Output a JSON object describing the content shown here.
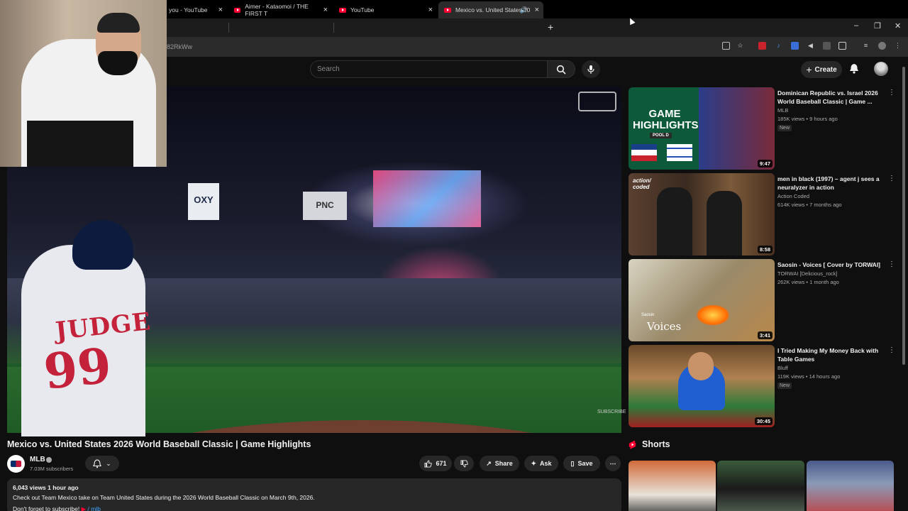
{
  "browser": {
    "tabs": [
      {
        "label": "you - YouTube",
        "active": false
      },
      {
        "label": "Aimer - Kataomoi / THE FIRST T",
        "active": false
      },
      {
        "label": "YouTube",
        "active": false
      },
      {
        "label": "Mexico vs. United States 20",
        "active": true
      }
    ],
    "new_tab": "+",
    "url_fragment": "82RkWw",
    "window_controls": {
      "minimize": "–",
      "restore": "❐",
      "close": "✕"
    }
  },
  "header": {
    "search_placeholder": "Search",
    "create_label": "Create"
  },
  "video": {
    "title": "Mexico vs. United States 2026 World Baseball Classic | Game Highlights",
    "jersey_name": "JUDGE",
    "jersey_number": "99",
    "ad_oxy": "OXY",
    "ad_pnc": "PNC",
    "watermark_subscribe": "SUBSCRIBE"
  },
  "channel": {
    "name": "MLB",
    "subscribers": "7.03M subscribers"
  },
  "actions": {
    "likes": "671",
    "share": "Share",
    "ask": "Ask",
    "save": "Save"
  },
  "description": {
    "meta": "6,043 views  1 hour ago",
    "line1": "Check out Team Mexico take on Team United States during the 2026 World Baseball Classic on March 9th, 2026.",
    "line2": "Don't forget to subscribe! ",
    "link": " / mlb"
  },
  "recommendations": [
    {
      "title": "Dominican Republic vs. Israel 2026 World Baseball Classic | Game ...",
      "channel": "MLB",
      "stats": "185K views • 9 hours ago",
      "badge": "New",
      "duration": "9:47",
      "thumb_text": "GAME HIGHLIGHTS",
      "thumb_sub": "POOL D"
    },
    {
      "title": "men in black (1997) – agent j sees a neuralyzer in action",
      "channel": "Action Coded",
      "stats": "614K views • 7 months ago",
      "badge": "",
      "duration": "8:58",
      "thumb_text": "action/ coded"
    },
    {
      "title": "Saosin - Voices  [ Cover by TORWAI]",
      "channel": "TORWAI [Delicious_rock]",
      "stats": "262K views • 1 month ago",
      "badge": "",
      "duration": "3:41",
      "thumb_text": "Voices",
      "thumb_sub": "Saosin"
    },
    {
      "title": "I Tried Making My Money Back with Table Games",
      "channel": "Bluff",
      "stats": "119K views • 14 hours ago",
      "badge": "New",
      "duration": "30:45"
    }
  ],
  "shorts": {
    "heading": "Shorts"
  },
  "icons": {
    "menu": "⋮",
    "accent": "#ff0033"
  }
}
